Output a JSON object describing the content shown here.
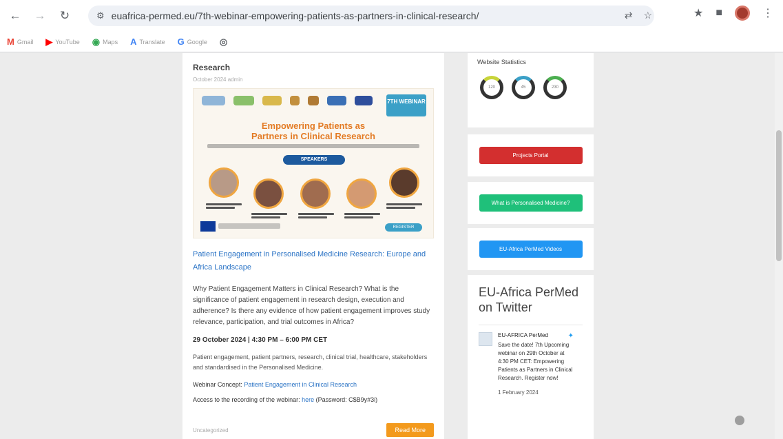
{
  "browser": {
    "url": "euafrica-permed.eu/7th-webinar-empowering-patients-as-partners-in-clinical-research/",
    "bookmarks": [
      {
        "label": "Gmail",
        "icon": "gmail-icon",
        "color": "#ea4335"
      },
      {
        "label": "YouTube",
        "icon": "youtube-icon",
        "color": "#ff0000"
      },
      {
        "label": "Maps",
        "icon": "maps-icon",
        "color": "#34a853"
      },
      {
        "label": "Translate",
        "icon": "translate-icon",
        "color": "#4285f4"
      },
      {
        "label": "Google",
        "icon": "google-icon",
        "color": "#4285f4"
      },
      {
        "label": "",
        "icon": "chrome-web-store-icon",
        "color": "#5f6368"
      }
    ]
  },
  "post": {
    "title": "Research",
    "meta": "October 2024   admin",
    "banner": {
      "badge": "7TH WEBINAR",
      "title_line1": "Empowering Patients as",
      "title_line2": "Partners in Clinical Research",
      "speakers_label": "SPEAKERS",
      "register_label": "REGISTER"
    },
    "link": "Patient Engagement in Personalised Medicine Research: Europe and Africa Landscape",
    "body": "Why Patient Engagement Matters in Clinical Research? What is the significance of patient engagement in research design, execution and adherence? Is there any evidence of how patient engagement improves study relevance, participation, and trial outcomes in Africa?",
    "date": "29 October 2024 | 4:30 PM – 6:00 PM CET",
    "small": "Patient engagement, patient partners, research, clinical trial, healthcare, stakeholders and standardised in the Personalised Medicine.",
    "concept_label": "Webinar Concept:",
    "concept_link": "Patient Engagement in Clinical Research",
    "recording_label": "Access to the recording of the webinar:",
    "recording_link": "here",
    "recording_note": "(Password: C$B9y#3i)",
    "tags": "Uncategorized",
    "read_more": "Read More"
  },
  "sidebar": {
    "stats_title": "Website Statistics",
    "rings": [
      "120",
      "45",
      "230"
    ],
    "buttons": [
      {
        "label": "Projects Portal",
        "color": "#d32f2f"
      },
      {
        "label": "What is Personalised Medicine?",
        "color": "#1fc07a"
      },
      {
        "label": "EU-Africa PerMed Videos",
        "color": "#2196f3"
      }
    ],
    "twitter": {
      "heading": "EU-Africa PerMed on Twitter",
      "account": "EU-AFRICA PerMed",
      "tweet": "Save the date! 7th Upcoming webinar on 29th October at 4:30 PM CET: Empowering Patients as Partners in Clinical Research. Register now!",
      "date": "1 February 2024"
    }
  }
}
